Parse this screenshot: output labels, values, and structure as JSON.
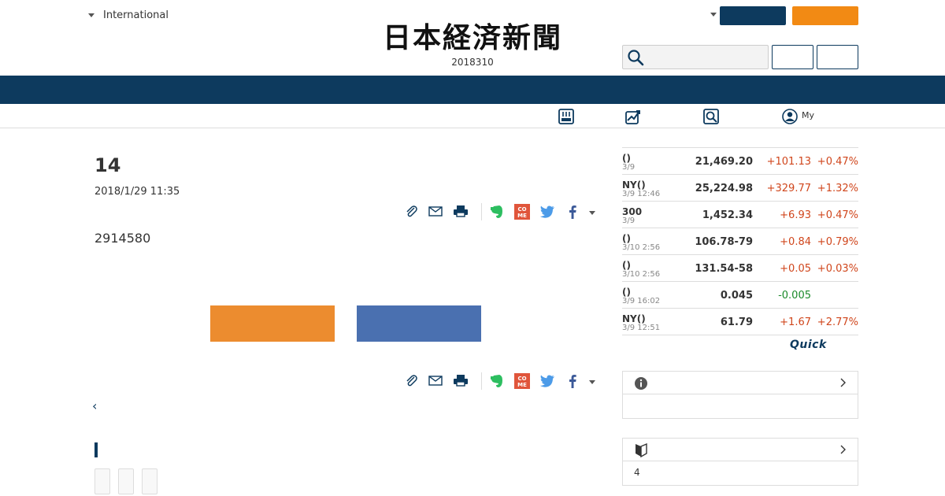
{
  "header": {
    "edition_label": "International",
    "logo_text": "日本経済新聞",
    "date": "2018310"
  },
  "subnav": {
    "my_label": "My"
  },
  "article": {
    "title": "14",
    "date": "2018/1/29 11:35",
    "body": "2914580",
    "back_link": "‹"
  },
  "market": {
    "rows": [
      {
        "name": "()",
        "time": "3/9",
        "value": "21,469.20",
        "change": "+101.13",
        "percent": "+0.47%"
      },
      {
        "name": "NY()",
        "time": "3/9 12:46",
        "value": "25,224.98",
        "change": "+329.77",
        "percent": "+1.32%"
      },
      {
        "name": "300",
        "time": "3/9",
        "value": "1,452.34",
        "change": "+6.93",
        "percent": "+0.47%"
      },
      {
        "name": "()",
        "time": "3/10 2:56",
        "value": "106.78-79",
        "change": "+0.84",
        "percent": "+0.79%"
      },
      {
        "name": "()",
        "time": "3/10 2:56",
        "value": "131.54-58",
        "change": "+0.05",
        "percent": "+0.03%"
      },
      {
        "name": "()",
        "time": "3/9 16:02",
        "value": "0.045",
        "change": "-0.005",
        "percent": ""
      },
      {
        "name": "NY()",
        "time": "3/9 12:51",
        "value": "61.79",
        "change": "+1.67",
        "percent": "+2.77%"
      }
    ],
    "provider": "Quick"
  },
  "panels": {
    "info_body": "",
    "beginner_body": "4"
  },
  "colors": {
    "navy": "#0d3a5e",
    "orange": "#f28a14",
    "up": "#d0461c",
    "down": "#1a8a2a"
  }
}
